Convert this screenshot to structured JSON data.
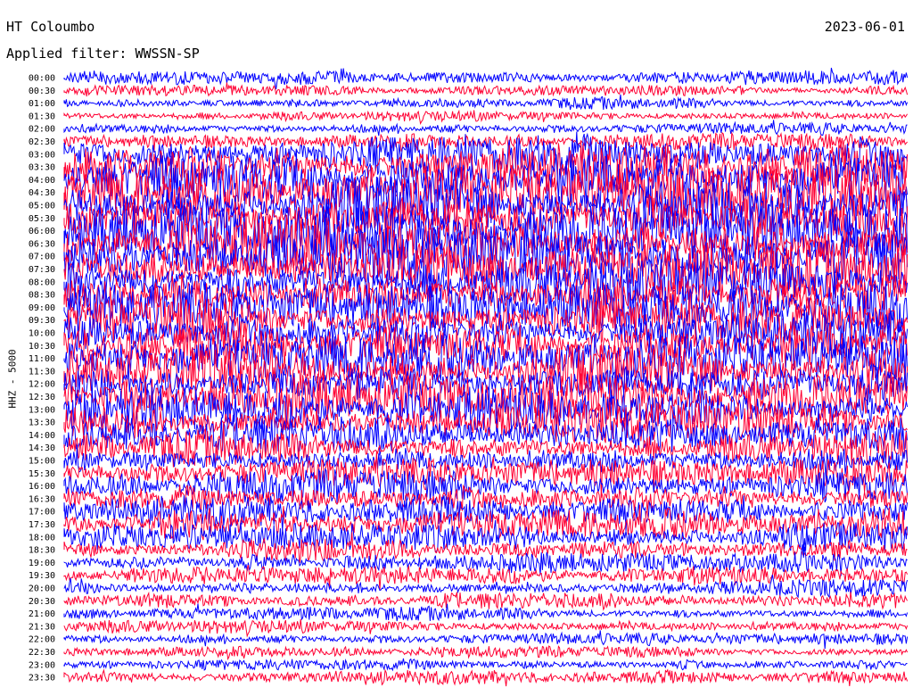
{
  "header": {
    "station": "HT Coloumbo",
    "filter": "Applied filter: WWSSN-SP",
    "date": "2023-06-01",
    "channel": "HHZ - 5000"
  },
  "colors": {
    "trace_a": "#0000ff",
    "trace_b": "#ff0033",
    "background": "#ffffff"
  },
  "chart_data": {
    "type": "helicorder",
    "title": "HT Coloumbo",
    "ylabel": "HHZ - 5000",
    "row_labels": [
      "00:00",
      "00:30",
      "01:00",
      "01:30",
      "02:00",
      "02:30",
      "03:00",
      "03:30",
      "04:00",
      "04:30",
      "05:00",
      "05:30",
      "06:00",
      "06:30",
      "07:00",
      "07:30",
      "08:00",
      "08:30",
      "09:00",
      "09:30",
      "10:00",
      "10:30",
      "11:00",
      "11:30",
      "12:00",
      "12:30",
      "13:00",
      "13:30",
      "14:00",
      "14:30",
      "15:00",
      "15:30",
      "16:00",
      "16:30",
      "17:00",
      "17:30",
      "18:00",
      "18:30",
      "19:00",
      "19:30",
      "20:00",
      "20:30",
      "21:00",
      "21:30",
      "22:00",
      "22:30",
      "23:00",
      "23:30"
    ],
    "relative_amplitude": [
      0.25,
      0.18,
      0.22,
      0.2,
      0.22,
      0.3,
      0.75,
      0.85,
      1.0,
      1.0,
      1.0,
      1.0,
      1.0,
      1.0,
      1.0,
      1.0,
      1.0,
      0.95,
      0.9,
      0.85,
      0.8,
      0.8,
      0.85,
      0.9,
      0.85,
      0.8,
      0.75,
      0.7,
      0.7,
      0.65,
      0.6,
      0.55,
      0.6,
      0.55,
      0.55,
      0.55,
      0.5,
      0.45,
      0.35,
      0.3,
      0.3,
      0.3,
      0.25,
      0.25,
      0.22,
      0.2,
      0.2,
      0.25
    ],
    "row_color_pattern": [
      "trace_a",
      "trace_b"
    ],
    "grid": false
  }
}
